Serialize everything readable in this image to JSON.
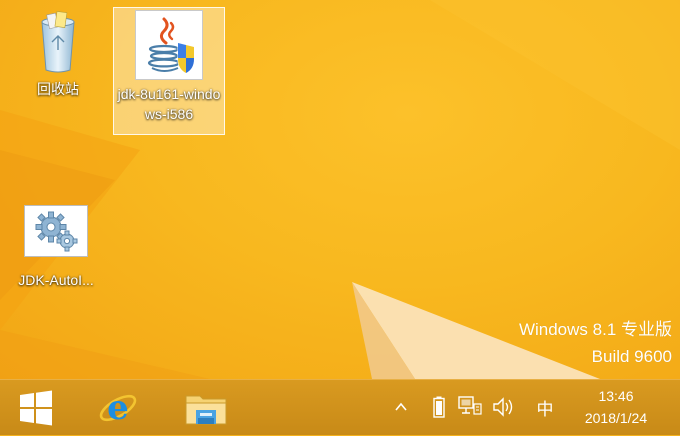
{
  "desktop": {
    "icons": [
      {
        "label": "回收站",
        "icon": "recycle-bin-icon"
      },
      {
        "label": "jdk-8u161-windows-i586",
        "icon": "java-installer-icon",
        "selected": true
      },
      {
        "label": "JDK-AutoI...",
        "icon": "settings-gears-icon"
      }
    ],
    "watermark": {
      "line1": "Windows 8.1 专业版",
      "line2": "Build 9600"
    }
  },
  "taskbar": {
    "start_icon": "windows-logo-icon",
    "pinned": [
      {
        "icon": "internet-explorer-icon"
      },
      {
        "icon": "file-explorer-icon"
      }
    ],
    "tray": {
      "show_hidden_icon": "chevron-up-icon",
      "battery_icon": "battery-icon",
      "network_icon": "network-icon",
      "volume_icon": "volume-icon",
      "ime": "中"
    },
    "clock": {
      "time": "13:46",
      "date": "2018/1/24"
    }
  },
  "colors": {
    "desktop": "#f8b81f",
    "taskbar": "#d1921b",
    "selection": "#ffffff"
  }
}
